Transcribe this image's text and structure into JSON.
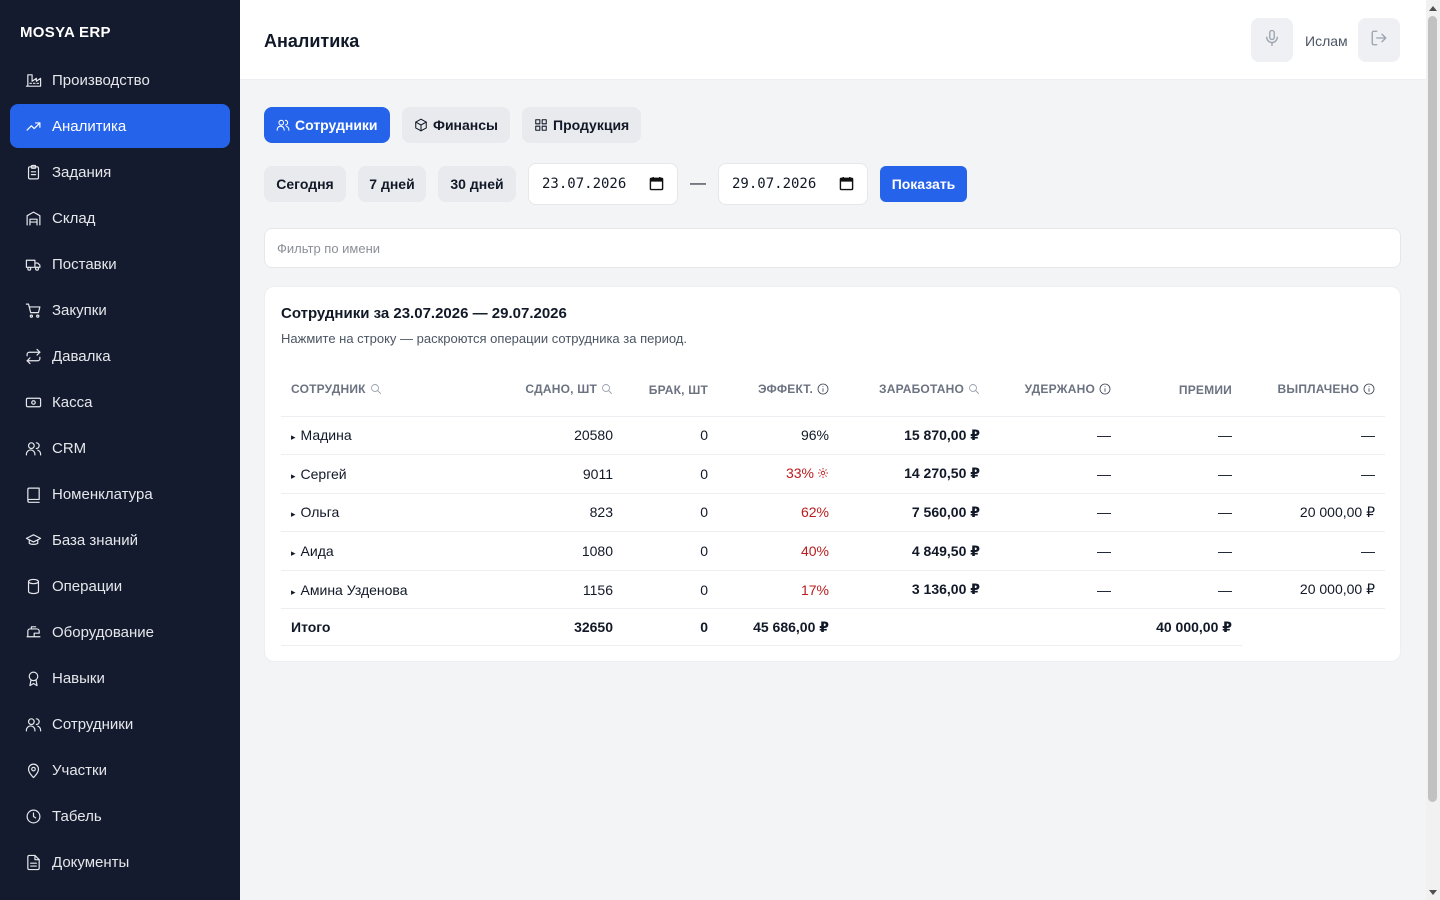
{
  "app": {
    "brand": "MOSYA ERP"
  },
  "sidebar": {
    "items": [
      {
        "label": "Производство",
        "icon": "factory-icon"
      },
      {
        "label": "Аналитика",
        "icon": "trending-up-icon",
        "active": true
      },
      {
        "label": "Задания",
        "icon": "clipboard-icon"
      },
      {
        "label": "Склад",
        "icon": "warehouse-icon"
      },
      {
        "label": "Поставки",
        "icon": "truck-icon"
      },
      {
        "label": "Закупки",
        "icon": "cart-icon"
      },
      {
        "label": "Давалка",
        "icon": "repeat-icon"
      },
      {
        "label": "Касса",
        "icon": "banknote-icon"
      },
      {
        "label": "CRM",
        "icon": "users-icon"
      },
      {
        "label": "Номенклатура",
        "icon": "book-icon"
      },
      {
        "label": "База знаний",
        "icon": "graduation-cap-icon"
      },
      {
        "label": "Операции",
        "icon": "cylinder-icon"
      },
      {
        "label": "Оборудование",
        "icon": "sewing-machine-icon"
      },
      {
        "label": "Навыки",
        "icon": "award-icon"
      },
      {
        "label": "Сотрудники",
        "icon": "users-icon"
      },
      {
        "label": "Участки",
        "icon": "map-pin-icon"
      },
      {
        "label": "Табель",
        "icon": "clock-icon"
      },
      {
        "label": "Документы",
        "icon": "file-text-icon"
      }
    ]
  },
  "header": {
    "title": "Аналитика",
    "user": "Ислам"
  },
  "tabs": [
    {
      "label": "Сотрудники",
      "icon": "users-icon",
      "active": true
    },
    {
      "label": "Финансы",
      "icon": "box-icon"
    },
    {
      "label": "Продукция",
      "icon": "grid-icon"
    }
  ],
  "period": {
    "today": "Сегодня",
    "week": "7 дней",
    "month": "30 дней",
    "from": "23.07.2026",
    "to": "29.07.2026",
    "separator": "—",
    "show": "Показать"
  },
  "filter": {
    "placeholder": "Фильтр по имени"
  },
  "report": {
    "title": "Сотрудники за 23.07.2026 — 29.07.2026",
    "subtitle": "Нажмите на строку — раскроются операции сотрудника за период.",
    "columns": {
      "employee": "Сотрудник",
      "submitted": "Сдано, шт",
      "defect": "Брак, шт",
      "efficiency": "Эффект.",
      "earned": "Заработано",
      "withheld": "Удержано",
      "bonuses": "Премии",
      "paid": "Выплачено"
    },
    "rows": [
      {
        "name": "Мадина",
        "submitted": "20580",
        "defect": "0",
        "efficiency": "96%",
        "earned": "15 870,00 ₽",
        "withheld": "—",
        "bonuses": "—",
        "paid": "—"
      },
      {
        "name": "Сергей",
        "submitted": "9011",
        "defect": "0",
        "efficiency": "33%",
        "earned": "14 270,50 ₽",
        "withheld": "—",
        "bonuses": "—",
        "paid": "—"
      },
      {
        "name": "Ольга",
        "submitted": "823",
        "defect": "0",
        "efficiency": "62%",
        "earned": "7 560,00 ₽",
        "withheld": "—",
        "bonuses": "—",
        "paid": "20 000,00 ₽"
      },
      {
        "name": "Аида",
        "submitted": "1080",
        "defect": "0",
        "efficiency": "40%",
        "earned": "4 849,50 ₽",
        "withheld": "—",
        "bonuses": "—",
        "paid": "—"
      },
      {
        "name": "Амина Узденова",
        "submitted": "1156",
        "defect": "0",
        "efficiency": "17%",
        "earned": "3 136,00 ₽",
        "withheld": "—",
        "bonuses": "—",
        "paid": "20 000,00 ₽"
      }
    ],
    "total": {
      "label": "Итого",
      "submitted": "32650",
      "defect": "0",
      "earned": "45 686,00 ₽",
      "bonuses": "40 000,00 ₽"
    }
  },
  "colors": {
    "accent": "#2563eb",
    "sidebar": "#151b2e",
    "danger": "#b91c1c"
  }
}
